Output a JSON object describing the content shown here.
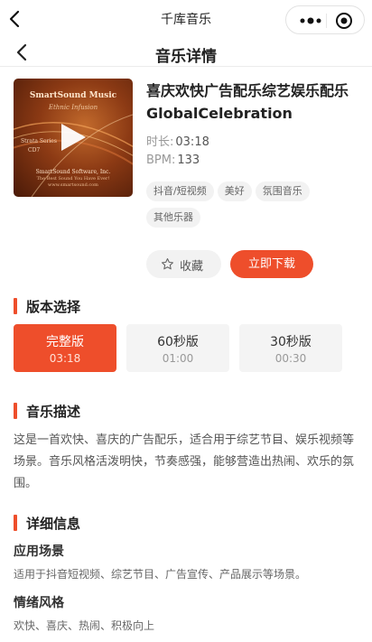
{
  "app": {
    "title": "千库音乐"
  },
  "page": {
    "title": "音乐详情"
  },
  "cover": {
    "brand": "SmartSound Music",
    "subtitle": "Ethnic Infusion",
    "series": "Strata Series",
    "cd": "CD7",
    "company": "SmartSound Software, Inc.",
    "tagline": "The Best Sound You Have Ever!",
    "url": "www.smartsound.com"
  },
  "track": {
    "title": "喜庆欢快广告配乐综艺娱乐配乐GlobalCelebration",
    "duration_label": "时长:",
    "duration": "03:18",
    "bpm_label": "BPM:",
    "bpm": "133",
    "tags": [
      "抖音/短视频",
      "美好",
      "氛围音乐",
      "其他乐器"
    ]
  },
  "actions": {
    "favorite": "收藏",
    "download": "立即下载"
  },
  "sections": {
    "version": "版本选择",
    "description": "音乐描述",
    "details": "详细信息"
  },
  "versions": [
    {
      "name": "完整版",
      "time": "03:18",
      "selected": true
    },
    {
      "name": "60秒版",
      "time": "01:00",
      "selected": false
    },
    {
      "name": "30秒版",
      "time": "00:30",
      "selected": false
    }
  ],
  "description": "这是一首欢快、喜庆的广告配乐，适合用于综艺节目、娱乐视频等场景。音乐风格活泼明快，节奏感强，能够营造出热闹、欢乐的氛围。",
  "details": {
    "scene_label": "应用场景",
    "scene": "适用于抖音短视频、综艺节目、广告宣传、产品展示等场景。",
    "mood_label": "情绪风格",
    "mood": "欢快、喜庆、热闹、积极向上"
  },
  "colors": {
    "accent": "#ee4e2b",
    "chip": "#f2f2f2"
  },
  "icons": {
    "top_back": "back-arrow-icon",
    "more": "more-dots-icon",
    "close": "target-close-icon",
    "page_back": "back-arrow-icon",
    "play": "play-icon",
    "favorite": "star-outline-icon"
  }
}
